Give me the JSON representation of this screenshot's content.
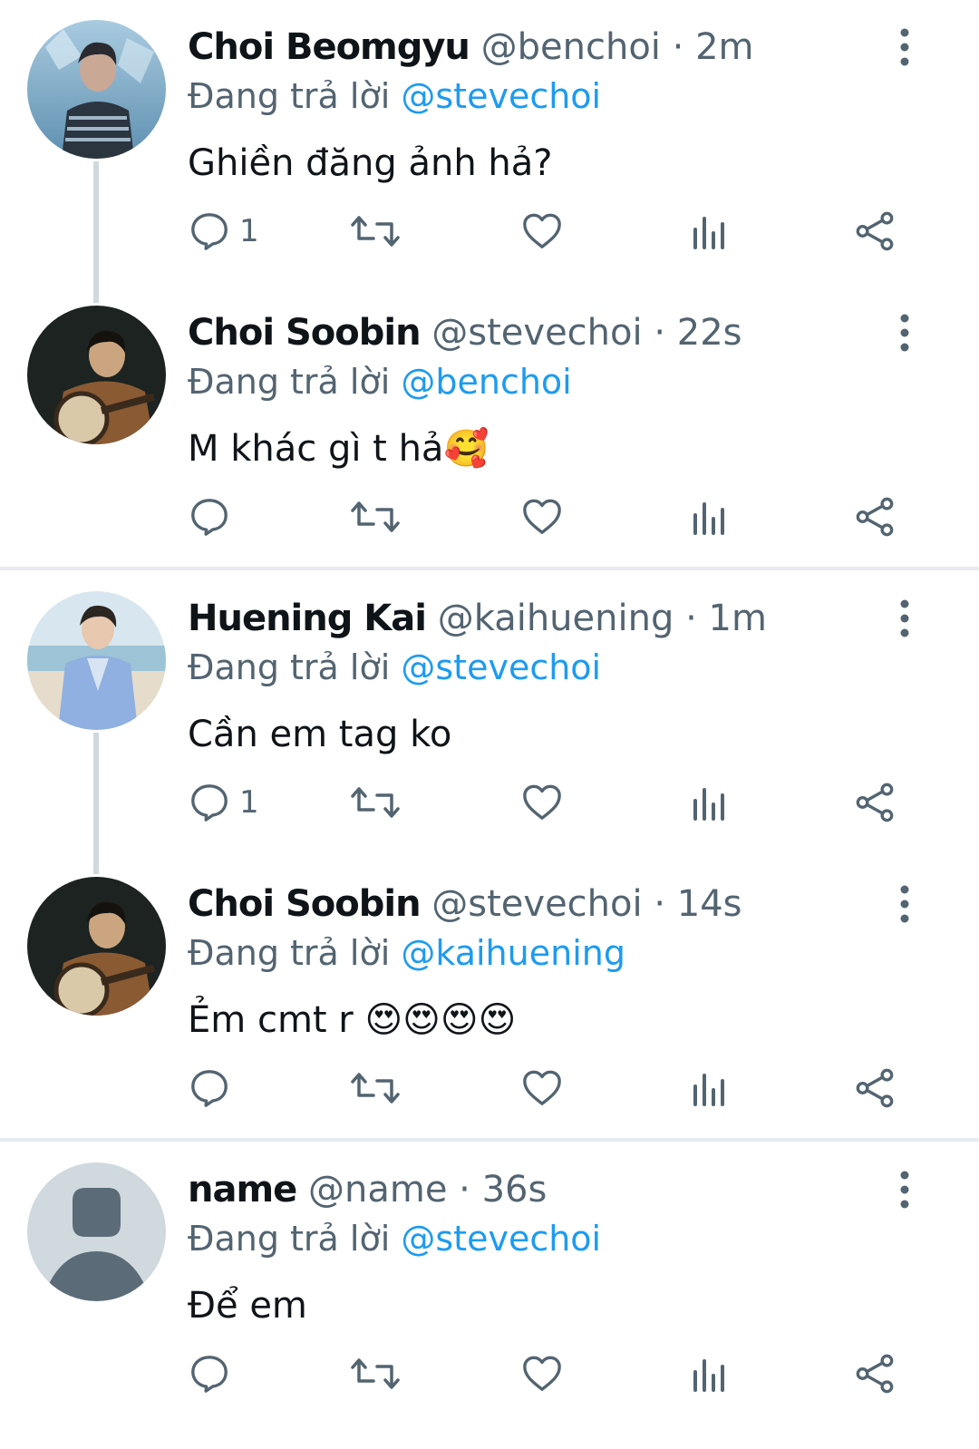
{
  "colors": {
    "accent": "#1d9bf0",
    "muted": "#536471",
    "text": "#0f1419",
    "thread": "#cfd9de"
  },
  "icons": [
    "reply-icon",
    "retweet-icon",
    "like-icon",
    "views-icon",
    "share-icon",
    "more-icon"
  ],
  "tweets": [
    {
      "name": "Choi Beomgyu",
      "handle": "@benchoi",
      "sep": "·",
      "time": "2m",
      "reply_prefix": "Đang trả lời",
      "reply_to": "@stevechoi",
      "text": "Ghiền đăng ảnh hả?",
      "emoji": "",
      "reply_count": "1"
    },
    {
      "name": "Choi Soobin",
      "handle": "@stevechoi",
      "sep": "·",
      "time": "22s",
      "reply_prefix": "Đang trả lời",
      "reply_to": "@benchoi",
      "text": "M khác gì t hả",
      "emoji": "🥰",
      "reply_count": ""
    },
    {
      "name": "Huening Kai",
      "handle": "@kaihuening",
      "sep": "·",
      "time": "1m",
      "reply_prefix": "Đang trả lời",
      "reply_to": "@stevechoi",
      "text": "Cần em tag ko",
      "emoji": "",
      "reply_count": "1"
    },
    {
      "name": "Choi Soobin",
      "handle": "@stevechoi",
      "sep": "·",
      "time": "14s",
      "reply_prefix": "Đang trả lời",
      "reply_to": "@kaihuening",
      "text": "Ẻm cmt r ",
      "emoji": "😍😍😍😍",
      "reply_count": ""
    },
    {
      "name": "name",
      "handle": "@name",
      "sep": "·",
      "time": "36s",
      "reply_prefix": "Đang trả lời",
      "reply_to": "@stevechoi",
      "text": "Để em",
      "emoji": "",
      "reply_count": ""
    }
  ]
}
